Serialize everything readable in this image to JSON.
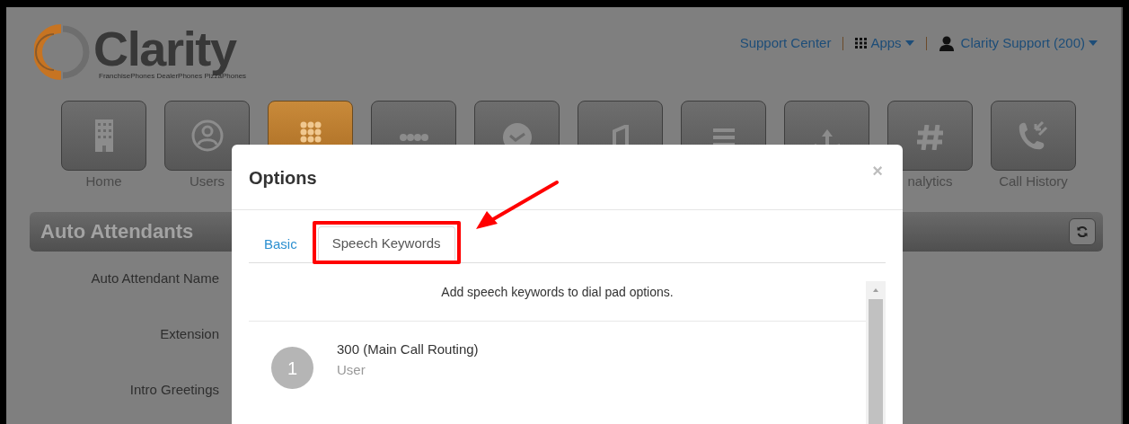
{
  "logo": {
    "name": "Clarity",
    "tagline": "FranchisePhones DealerPhones PizzaPhones"
  },
  "top_links": [
    {
      "kind": "link",
      "label": "Support Center"
    },
    {
      "kind": "apps",
      "label": "Apps"
    },
    {
      "kind": "user",
      "label": "Clarity Support (200)"
    }
  ],
  "nav_tiles": [
    {
      "label": "Home",
      "selected": false
    },
    {
      "label": "Users",
      "selected": false
    },
    {
      "selected": true
    },
    {
      "selected": false
    },
    {
      "selected": false
    },
    {
      "selected": false
    },
    {
      "selected": false
    },
    {
      "selected": false
    },
    {
      "label": "nalytics",
      "selected": false
    },
    {
      "label": "Call History",
      "selected": false
    }
  ],
  "section": {
    "title": "Auto Attendants"
  },
  "form_labels": [
    "Auto Attendant Name",
    "Extension",
    "Intro Greetings"
  ],
  "modal": {
    "title": "Options",
    "close": "×",
    "tabs": [
      {
        "label": "Basic",
        "selected": false
      },
      {
        "label": "Speech Keywords",
        "selected": true
      }
    ],
    "intro": "Add speech keywords to dial pad options.",
    "options": [
      {
        "number": "1",
        "title": "300 (Main Call Routing)",
        "subtitle": "User"
      }
    ]
  }
}
